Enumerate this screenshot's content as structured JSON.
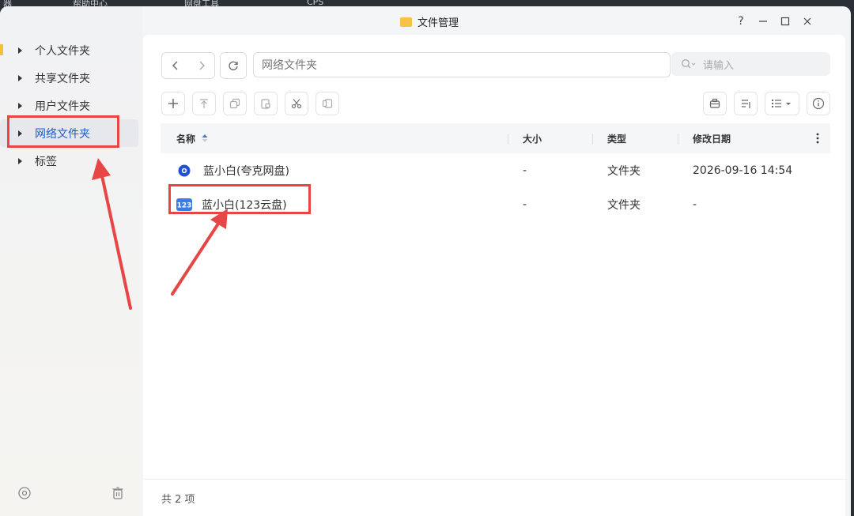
{
  "taskbar": {
    "items": [
      "器",
      "帮助中心",
      "网盘工具",
      "CPS"
    ]
  },
  "window": {
    "title": "文件管理",
    "help_label": "?"
  },
  "sidebar": {
    "items": [
      {
        "label": "个人文件夹",
        "active": false
      },
      {
        "label": "共享文件夹",
        "active": false
      },
      {
        "label": "用户文件夹",
        "active": false
      },
      {
        "label": "网络文件夹",
        "active": true
      },
      {
        "label": "标签",
        "active": false
      }
    ]
  },
  "toolbar": {
    "path": "网络文件夹",
    "search_placeholder": "请输入"
  },
  "table": {
    "columns": [
      "名称",
      "大小",
      "类型",
      "修改日期"
    ],
    "rows": [
      {
        "name": "蓝小白(夸克网盘)",
        "size": "-",
        "type": "文件夹",
        "modified": "2026-09-16 14:54",
        "icon": "quark-drive-icon"
      },
      {
        "name": "蓝小白(123云盘)",
        "size": "-",
        "type": "文件夹",
        "modified": "-",
        "icon": "123-cloud-icon"
      }
    ]
  },
  "status": {
    "count_text": "共 2 项"
  },
  "annotations": {
    "highlight_color": "#e84545"
  }
}
